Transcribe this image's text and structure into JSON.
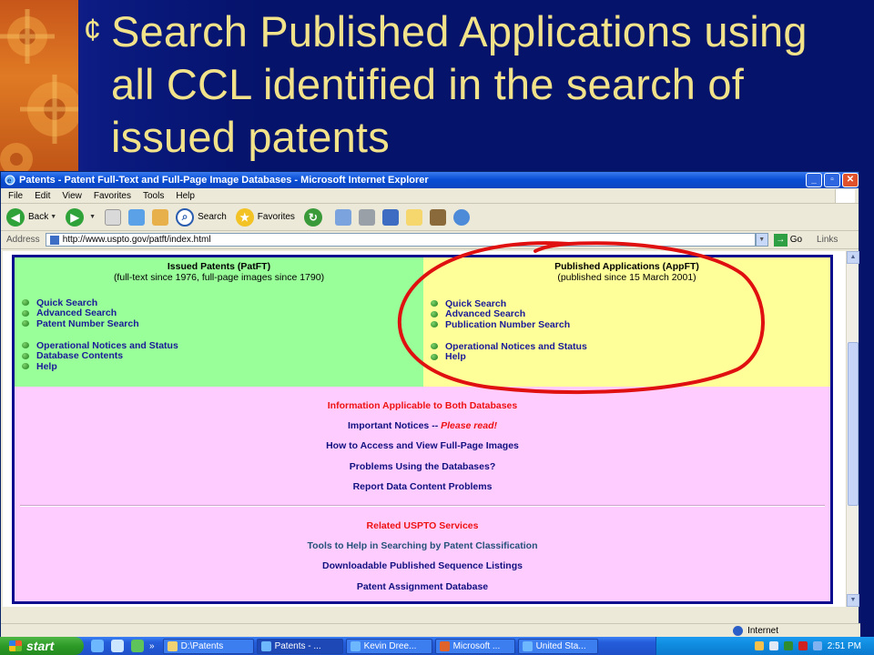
{
  "slide": {
    "title": "Search Published Applications using all CCL identified in the search of issued patents",
    "bullet": "¢"
  },
  "window": {
    "title": "Patents - Patent Full-Text and Full-Page Image Databases - Microsoft Internet Explorer",
    "menu": [
      "File",
      "Edit",
      "View",
      "Favorites",
      "Tools",
      "Help"
    ],
    "toolbar": {
      "back": "Back",
      "search": "Search",
      "favorites": "Favorites"
    },
    "address_label": "Address",
    "address_value": "http://www.uspto.gov/patft/index.html",
    "go_label": "Go",
    "links_label": "Links"
  },
  "page": {
    "left": {
      "heading": "Issued Patents (PatFT)",
      "subheading": "(full-text since 1976, full-page images since 1790)",
      "links_a": [
        "Quick Search",
        "Advanced Search",
        "Patent Number Search"
      ],
      "links_b": [
        "Operational Notices and Status",
        "Database Contents",
        "Help"
      ]
    },
    "right": {
      "heading": "Published Applications (AppFT)",
      "subheading": "(published since 15 March 2001)",
      "links_a": [
        "Quick Search",
        "Advanced Search",
        "Publication Number Search"
      ],
      "links_b": [
        "Operational Notices and Status",
        "Help"
      ]
    },
    "info": {
      "heading": "Information Applicable to Both Databases",
      "important_prefix": "Important Notices --",
      "important_flag": "Please read!",
      "items": [
        "How to Access and View Full-Page Images",
        "Problems Using the Databases?",
        "Report Data Content Problems"
      ]
    },
    "related": {
      "heading": "Related USPTO Services",
      "items": [
        "Tools to Help in Searching by Patent Classification",
        "Downloadable Published Sequence Listings",
        "Patent Assignment Database"
      ]
    }
  },
  "statusbar": {
    "zone": "Internet"
  },
  "taskbar": {
    "start": "start",
    "chevron": "»",
    "tasks": [
      "D:\\Patents",
      "Patents - ...",
      "Kevin Dree...",
      "Microsoft ...",
      "United Sta..."
    ],
    "clock": "2:51 PM"
  },
  "colors": {
    "slide_bg": "#05136b",
    "title_text": "#f2e38a",
    "patft_green": "#99ff99",
    "appft_yellow": "#ffff99",
    "info_pink": "#ffccff",
    "annotation_red": "#e01010"
  }
}
